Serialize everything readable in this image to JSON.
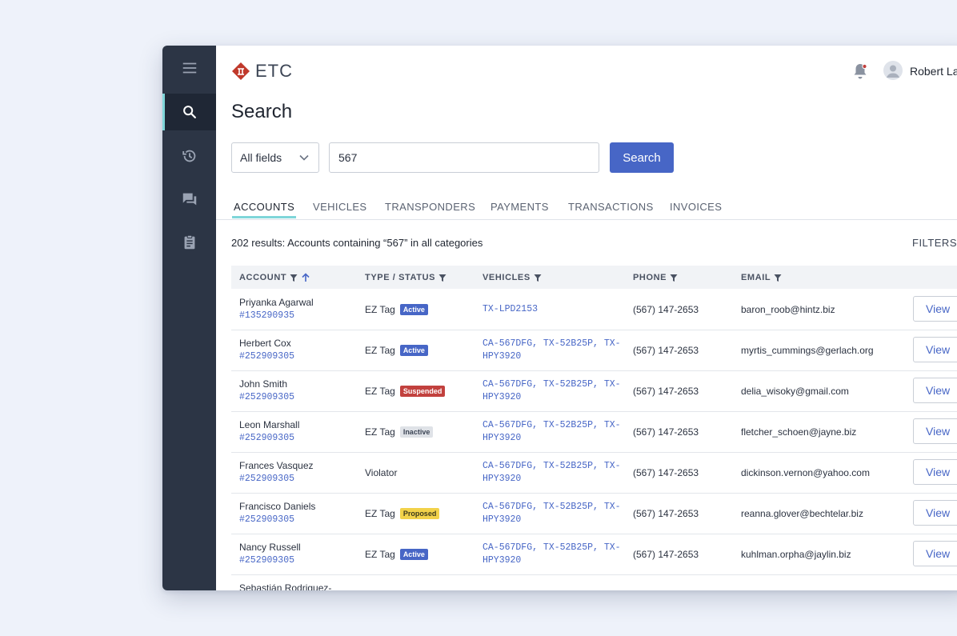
{
  "brand": {
    "name": "ETC"
  },
  "user": {
    "name": "Robert Lar"
  },
  "page": {
    "title": "Search"
  },
  "search": {
    "field_select": "All fields",
    "query": "567",
    "button_label": "Search"
  },
  "tabs": [
    {
      "label": "ACCOUNTS",
      "active": true
    },
    {
      "label": "VEHICLES"
    },
    {
      "label": "TRANSPONDERS"
    },
    {
      "label": "PAYMENTS"
    },
    {
      "label": "TRANSACTIONS"
    },
    {
      "label": "INVOICES"
    }
  ],
  "results": {
    "summary": "202 results: Accounts containing “567” in all categories",
    "filters_label": "FILTERS"
  },
  "table": {
    "columns": [
      "ACCOUNT",
      "TYPE / STATUS",
      "VEHICLES",
      "PHONE",
      "EMAIL"
    ],
    "view_label": "View",
    "rows": [
      {
        "name": "Priyanka Agarwal",
        "id": "#135290935",
        "type": "EZ Tag",
        "status": "Active",
        "vehicles": "TX-LPD2153",
        "phone": "(567) 147-2653",
        "email": "baron_roob@hintz.biz"
      },
      {
        "name": "Herbert Cox",
        "id": "#252909305",
        "type": "EZ Tag",
        "status": "Active",
        "vehicles": "CA-567DFG, TX-52B25P, TX-HPY3920",
        "phone": "(567) 147-2653",
        "email": "myrtis_cummings@gerlach.org"
      },
      {
        "name": "John Smith",
        "id": "#252909305",
        "type": "EZ Tag",
        "status": "Suspended",
        "vehicles": "CA-567DFG, TX-52B25P, TX-HPY3920",
        "phone": "(567) 147-2653",
        "email": "delia_wisoky@gmail.com"
      },
      {
        "name": "Leon Marshall",
        "id": "#252909305",
        "type": "EZ Tag",
        "status": "Inactive",
        "vehicles": "CA-567DFG, TX-52B25P, TX-HPY3920",
        "phone": "(567) 147-2653",
        "email": "fletcher_schoen@jayne.biz"
      },
      {
        "name": "Frances Vasquez",
        "id": "#252909305",
        "type": "Violator",
        "status": "",
        "vehicles": "CA-567DFG, TX-52B25P, TX-HPY3920",
        "phone": "(567) 147-2653",
        "email": "dickinson.vernon@yahoo.com"
      },
      {
        "name": "Francisco Daniels",
        "id": "#252909305",
        "type": "EZ Tag",
        "status": "Proposed",
        "vehicles": "CA-567DFG, TX-52B25P, TX-HPY3920",
        "phone": "(567) 147-2653",
        "email": "reanna.glover@bechtelar.biz"
      },
      {
        "name": "Nancy Russell",
        "id": "#252909305",
        "type": "EZ Tag",
        "status": "Active",
        "vehicles": "CA-567DFG, TX-52B25P, TX-HPY3920",
        "phone": "(567) 147-2653",
        "email": "kuhlman.orpha@jaylin.biz"
      },
      {
        "name": "Sebastián Rodriguez-",
        "id": "",
        "type": "",
        "status": "",
        "vehicles": "",
        "phone": "",
        "email": ""
      }
    ]
  },
  "colors": {
    "sidebar": "#2c3545",
    "accent": "#4766c6",
    "tab_indicator": "#7fd6d9",
    "suspended": "#c2413e",
    "proposed": "#f2d24a"
  },
  "icons": {
    "sidebar": [
      "menu-icon",
      "search-icon",
      "history-icon",
      "chat-icon",
      "clipboard-icon"
    ],
    "header": [
      "notification-bell-icon",
      "user-avatar-icon"
    ]
  }
}
